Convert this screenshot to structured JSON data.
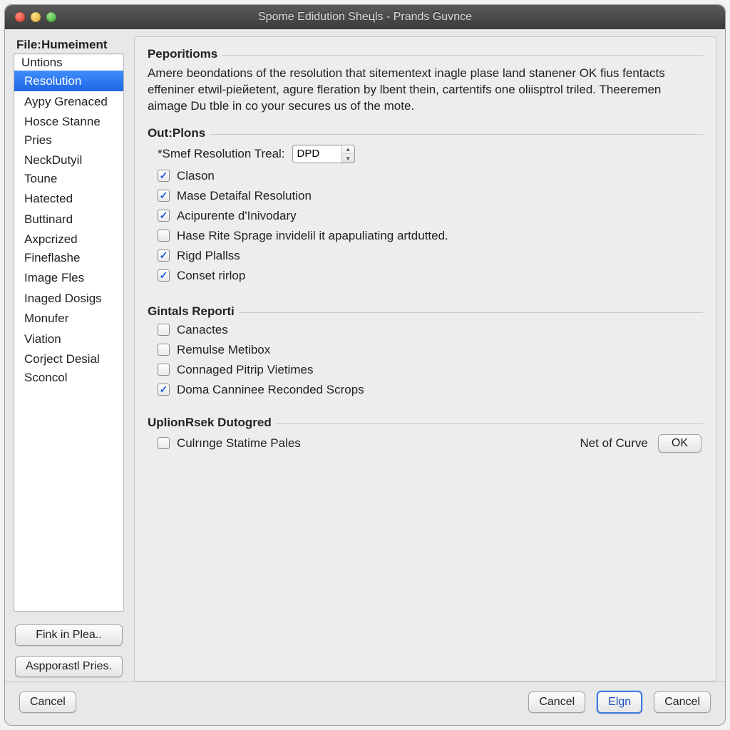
{
  "title": "Spome Edidution Sheцls - Prands Guvnce",
  "sidebar": {
    "header": "File:Humeiment",
    "subheader": "Untions",
    "items": [
      {
        "label": "Resolution",
        "selected": true
      },
      {
        "label": "Aypy Grenaced"
      },
      {
        "label": "Hosce Stanne Pries"
      },
      {
        "label": "NeckDutyil Toune"
      },
      {
        "label": "Hatected"
      },
      {
        "label": "Buttinard"
      },
      {
        "label": "Axpcrized Fineflashe"
      },
      {
        "label": "Image Fles"
      },
      {
        "label": "Inaged Dosigs"
      },
      {
        "label": "Monufer"
      },
      {
        "label": "Viation"
      },
      {
        "label": "Corject Desial Sconcol"
      }
    ],
    "buttons": {
      "fink": "Fink in Plea..",
      "asp": "Aspporastl Pries."
    }
  },
  "main": {
    "desc_title": "Peporitioms",
    "description": "Amere beondations of the resolution that sitementext inagle plase land stanener OK fius fentacts effeniner etwil-piейetent, agure fleration by lbent thein, cartentifs one oliisptrol triled. Theeremen aimage Du tble in co your secures us of the mote.",
    "out": {
      "title": "Out:Plons",
      "res_label": "*Smef Resolution Treal:",
      "res_value": "DPD",
      "checks": [
        {
          "label": "Clason",
          "checked": true
        },
        {
          "label": "Mase Detaifal Resolution",
          "checked": true
        },
        {
          "label": "Acipurente d'Inivodary",
          "checked": true
        },
        {
          "label": "Hase Rite Sprage invidelil it apapuliating artdutted.",
          "checked": false
        },
        {
          "label": "Rigd Plallss",
          "checked": true
        },
        {
          "label": "Conset rirlop",
          "checked": true
        }
      ]
    },
    "gintals": {
      "title": "Gintals Reporti",
      "checks": [
        {
          "label": "Canactes",
          "checked": false
        },
        {
          "label": "Remulse Metibox",
          "checked": false
        },
        {
          "label": "Connaged Pitrip Vietimes",
          "checked": false
        },
        {
          "label": "Doma Canninee Reconded Scrops",
          "checked": true
        }
      ]
    },
    "uplink": {
      "title": "UplionRsek Dutogred",
      "check_label": "Culrınge Statime Pales",
      "check_checked": false,
      "net_label": "Net of Curve",
      "ok_label": "OK"
    }
  },
  "footer": {
    "left": "Cancel",
    "b1": "Cancel",
    "b2": "Elgn",
    "b3": "Cancel"
  }
}
